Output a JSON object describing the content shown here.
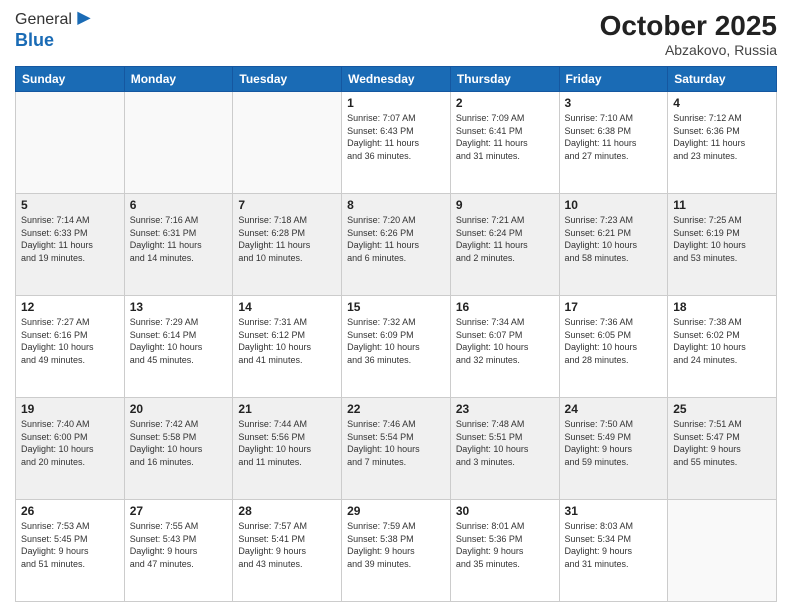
{
  "header": {
    "logo_line1": "General",
    "logo_line2": "Blue",
    "month": "October 2025",
    "location": "Abzakovo, Russia"
  },
  "days_of_week": [
    "Sunday",
    "Monday",
    "Tuesday",
    "Wednesday",
    "Thursday",
    "Friday",
    "Saturday"
  ],
  "weeks": [
    {
      "shaded": false,
      "days": [
        {
          "num": "",
          "info": ""
        },
        {
          "num": "",
          "info": ""
        },
        {
          "num": "",
          "info": ""
        },
        {
          "num": "1",
          "info": "Sunrise: 7:07 AM\nSunset: 6:43 PM\nDaylight: 11 hours\nand 36 minutes."
        },
        {
          "num": "2",
          "info": "Sunrise: 7:09 AM\nSunset: 6:41 PM\nDaylight: 11 hours\nand 31 minutes."
        },
        {
          "num": "3",
          "info": "Sunrise: 7:10 AM\nSunset: 6:38 PM\nDaylight: 11 hours\nand 27 minutes."
        },
        {
          "num": "4",
          "info": "Sunrise: 7:12 AM\nSunset: 6:36 PM\nDaylight: 11 hours\nand 23 minutes."
        }
      ]
    },
    {
      "shaded": true,
      "days": [
        {
          "num": "5",
          "info": "Sunrise: 7:14 AM\nSunset: 6:33 PM\nDaylight: 11 hours\nand 19 minutes."
        },
        {
          "num": "6",
          "info": "Sunrise: 7:16 AM\nSunset: 6:31 PM\nDaylight: 11 hours\nand 14 minutes."
        },
        {
          "num": "7",
          "info": "Sunrise: 7:18 AM\nSunset: 6:28 PM\nDaylight: 11 hours\nand 10 minutes."
        },
        {
          "num": "8",
          "info": "Sunrise: 7:20 AM\nSunset: 6:26 PM\nDaylight: 11 hours\nand 6 minutes."
        },
        {
          "num": "9",
          "info": "Sunrise: 7:21 AM\nSunset: 6:24 PM\nDaylight: 11 hours\nand 2 minutes."
        },
        {
          "num": "10",
          "info": "Sunrise: 7:23 AM\nSunset: 6:21 PM\nDaylight: 10 hours\nand 58 minutes."
        },
        {
          "num": "11",
          "info": "Sunrise: 7:25 AM\nSunset: 6:19 PM\nDaylight: 10 hours\nand 53 minutes."
        }
      ]
    },
    {
      "shaded": false,
      "days": [
        {
          "num": "12",
          "info": "Sunrise: 7:27 AM\nSunset: 6:16 PM\nDaylight: 10 hours\nand 49 minutes."
        },
        {
          "num": "13",
          "info": "Sunrise: 7:29 AM\nSunset: 6:14 PM\nDaylight: 10 hours\nand 45 minutes."
        },
        {
          "num": "14",
          "info": "Sunrise: 7:31 AM\nSunset: 6:12 PM\nDaylight: 10 hours\nand 41 minutes."
        },
        {
          "num": "15",
          "info": "Sunrise: 7:32 AM\nSunset: 6:09 PM\nDaylight: 10 hours\nand 36 minutes."
        },
        {
          "num": "16",
          "info": "Sunrise: 7:34 AM\nSunset: 6:07 PM\nDaylight: 10 hours\nand 32 minutes."
        },
        {
          "num": "17",
          "info": "Sunrise: 7:36 AM\nSunset: 6:05 PM\nDaylight: 10 hours\nand 28 minutes."
        },
        {
          "num": "18",
          "info": "Sunrise: 7:38 AM\nSunset: 6:02 PM\nDaylight: 10 hours\nand 24 minutes."
        }
      ]
    },
    {
      "shaded": true,
      "days": [
        {
          "num": "19",
          "info": "Sunrise: 7:40 AM\nSunset: 6:00 PM\nDaylight: 10 hours\nand 20 minutes."
        },
        {
          "num": "20",
          "info": "Sunrise: 7:42 AM\nSunset: 5:58 PM\nDaylight: 10 hours\nand 16 minutes."
        },
        {
          "num": "21",
          "info": "Sunrise: 7:44 AM\nSunset: 5:56 PM\nDaylight: 10 hours\nand 11 minutes."
        },
        {
          "num": "22",
          "info": "Sunrise: 7:46 AM\nSunset: 5:54 PM\nDaylight: 10 hours\nand 7 minutes."
        },
        {
          "num": "23",
          "info": "Sunrise: 7:48 AM\nSunset: 5:51 PM\nDaylight: 10 hours\nand 3 minutes."
        },
        {
          "num": "24",
          "info": "Sunrise: 7:50 AM\nSunset: 5:49 PM\nDaylight: 9 hours\nand 59 minutes."
        },
        {
          "num": "25",
          "info": "Sunrise: 7:51 AM\nSunset: 5:47 PM\nDaylight: 9 hours\nand 55 minutes."
        }
      ]
    },
    {
      "shaded": false,
      "days": [
        {
          "num": "26",
          "info": "Sunrise: 7:53 AM\nSunset: 5:45 PM\nDaylight: 9 hours\nand 51 minutes."
        },
        {
          "num": "27",
          "info": "Sunrise: 7:55 AM\nSunset: 5:43 PM\nDaylight: 9 hours\nand 47 minutes."
        },
        {
          "num": "28",
          "info": "Sunrise: 7:57 AM\nSunset: 5:41 PM\nDaylight: 9 hours\nand 43 minutes."
        },
        {
          "num": "29",
          "info": "Sunrise: 7:59 AM\nSunset: 5:38 PM\nDaylight: 9 hours\nand 39 minutes."
        },
        {
          "num": "30",
          "info": "Sunrise: 8:01 AM\nSunset: 5:36 PM\nDaylight: 9 hours\nand 35 minutes."
        },
        {
          "num": "31",
          "info": "Sunrise: 8:03 AM\nSunset: 5:34 PM\nDaylight: 9 hours\nand 31 minutes."
        },
        {
          "num": "",
          "info": ""
        }
      ]
    }
  ]
}
